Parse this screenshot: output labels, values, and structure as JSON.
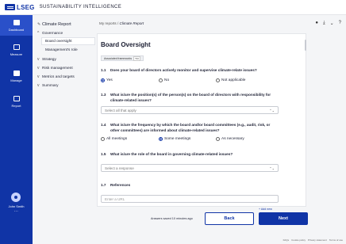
{
  "header": {
    "brand": "LSEG",
    "app_title": "SUSTAINABILITY INTELLIGENCE"
  },
  "leftnav": {
    "items": [
      {
        "label": "Dashboard",
        "icon": "dashboard-icon",
        "active": true
      },
      {
        "label": "Measure",
        "icon": "measure-icon"
      },
      {
        "label": "Manage",
        "icon": "manage-icon"
      },
      {
        "label": "Report",
        "icon": "report-icon"
      }
    ],
    "user_name": "John Smith",
    "user_more": "..."
  },
  "tree": {
    "root": "Climate Report",
    "governance": "Governance",
    "board_oversight": "Board oversight",
    "managements_role": "Management's role",
    "strategy": "Strategy",
    "risk_management": "Risk management",
    "metrics_targets": "Metrics and targets",
    "summary": "Summary",
    "chevron_open": "^",
    "chevron_closed": "v",
    "pencil": "✎"
  },
  "breadcrumb": {
    "root": "My reports",
    "sep": "/",
    "current": "Climate Report"
  },
  "toolbar": {
    "lightbulb": "●",
    "download": "⤓",
    "more": "⌄",
    "help": "?"
  },
  "page": {
    "title": "Board Oversight",
    "associated_label": "Associated frameworks",
    "associated_badge": "TCI"
  },
  "questions": {
    "q1": {
      "num": "1.1",
      "text": "Does your board of directors actively monitor and supervise climate-relate issues?",
      "options": [
        "Yes",
        "No",
        "Not applicable"
      ],
      "selected": 0
    },
    "q3": {
      "num": "1.3",
      "text": "What is/are the position(s) of the person(s) on the board of directors with responsibility for climate-related issues?",
      "placeholder": "Select all that apply"
    },
    "q4": {
      "num": "1.4",
      "text": "What is/are the frequency by which the board and/or board committees (e.g., audit, risk, or other committees) are informed about climate-related issues?",
      "options": [
        "All meetings",
        "Some meetings",
        "As necessary"
      ],
      "selected": 1
    },
    "q5": {
      "num": "1.5",
      "text": "What is/are the role of the board in governing climate-related issues?",
      "placeholder": "Select a response"
    },
    "q7": {
      "num": "1.7",
      "text": "References",
      "placeholder": "Enter a URL",
      "add_new": "+ Add new"
    }
  },
  "footer": {
    "saved": "Answers saved 10 minutes ago",
    "back": "Back",
    "next": "Next",
    "legal": [
      "FAQs",
      "Cookie policy",
      "Privacy statement",
      "Terms of use"
    ]
  }
}
